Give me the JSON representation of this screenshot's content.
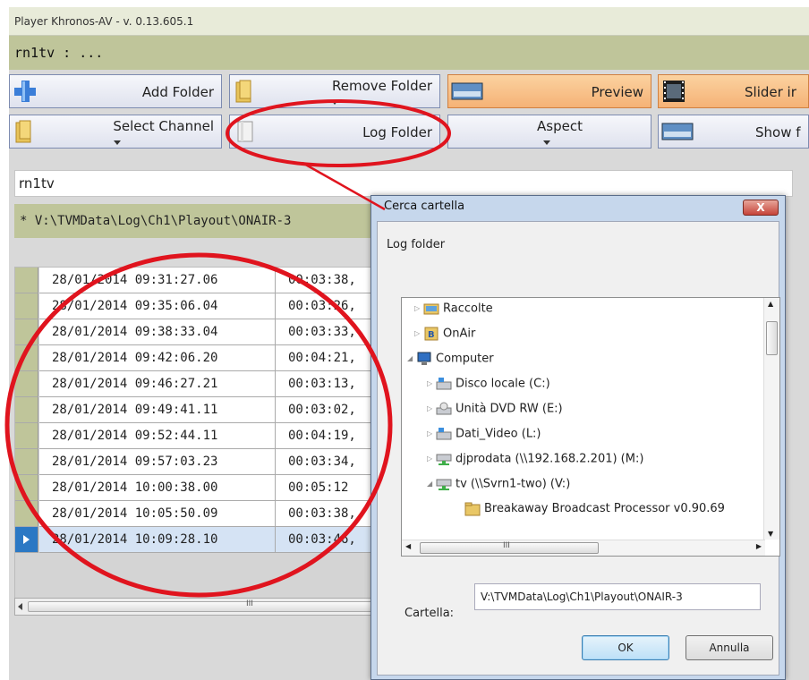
{
  "window": {
    "title": "Player Khronos-AV - v. 0.13.605.1",
    "channel_header": "rn1tv : ..."
  },
  "toolbar": {
    "row1": {
      "add_folder": "Add Folder",
      "remove_folder": "Remove Folder",
      "preview": "Preview",
      "slider": "Slider ir"
    },
    "row2": {
      "select_channel": "Select Channel",
      "log_folder": "Log Folder",
      "aspect": "Aspect",
      "show": "Show f"
    }
  },
  "channel_input": {
    "value": "rn1tv"
  },
  "path_bar": "* V:\\TVMData\\Log\\Ch1\\Playout\\ONAIR-3",
  "log_rows": [
    {
      "time": "28/01/2014 09:31:27.06",
      "duration": "00:03:38,"
    },
    {
      "time": "28/01/2014 09:35:06.04",
      "duration": "00:03:26,"
    },
    {
      "time": "28/01/2014 09:38:33.04",
      "duration": "00:03:33,"
    },
    {
      "time": "28/01/2014 09:42:06.20",
      "duration": "00:04:21,"
    },
    {
      "time": "28/01/2014 09:46:27.21",
      "duration": "00:03:13,"
    },
    {
      "time": "28/01/2014 09:49:41.11",
      "duration": "00:03:02,"
    },
    {
      "time": "28/01/2014 09:52:44.11",
      "duration": "00:04:19,"
    },
    {
      "time": "28/01/2014 09:57:03.23",
      "duration": "00:03:34,"
    },
    {
      "time": "28/01/2014 10:00:38.00",
      "duration": "00:05:12"
    },
    {
      "time": "28/01/2014 10:05:50.09",
      "duration": "00:03:38,"
    },
    {
      "time": "28/01/2014 10:09:28.10",
      "duration": "00:03:46,"
    }
  ],
  "selected_row_index": 10,
  "grid_scroll_grip": "III",
  "dialog": {
    "title": "Cerca cartella",
    "close_label": "X",
    "subtitle": "Log folder",
    "tree": [
      {
        "label": "Raccolte",
        "expander": "▷",
        "icon": "library-icon"
      },
      {
        "label": "OnAir",
        "expander": "▷",
        "icon": "onair-folder-icon"
      },
      {
        "label": "Computer",
        "expander": "◢",
        "icon": "computer-icon"
      },
      {
        "label": "Disco locale (C:)",
        "expander": "▷",
        "icon": "drive-icon"
      },
      {
        "label": "Unità DVD RW (E:)",
        "expander": "▷",
        "icon": "dvd-drive-icon"
      },
      {
        "label": "Dati_Video (L:)",
        "expander": "▷",
        "icon": "drive-icon"
      },
      {
        "label": "djprodata (\\\\192.168.2.201) (M:)",
        "expander": "▷",
        "icon": "network-drive-icon"
      },
      {
        "label": "tv (\\\\Svrn1-two) (V:)",
        "expander": "◢",
        "icon": "network-drive-icon"
      },
      {
        "label": "Breakaway Broadcast Processor v0.90.69",
        "expander": "",
        "icon": "folder-icon"
      }
    ],
    "tree_scroll_grip": "III",
    "folder_label": "Cartella:",
    "folder_value": "V:\\TVMData\\Log\\Ch1\\Playout\\ONAIR-3",
    "ok_label": "OK",
    "cancel_label": "Annulla"
  },
  "colors": {
    "header_olive": "#bfc59a",
    "toolbar_orange": "#f5b276",
    "annotation_red": "#e0141e",
    "selection_blue": "#2b78c4"
  }
}
